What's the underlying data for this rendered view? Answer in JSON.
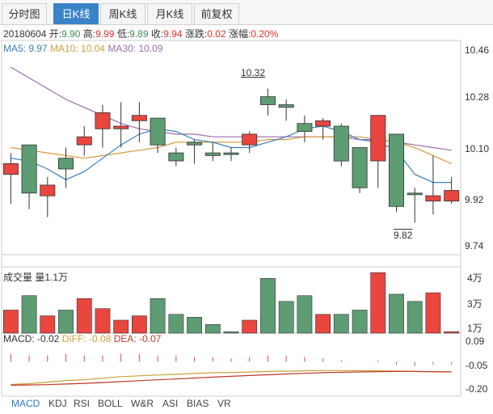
{
  "tabs": [
    {
      "label": "分时图",
      "active": false
    },
    {
      "label": "日K线",
      "active": true
    },
    {
      "label": "周K线",
      "active": false
    },
    {
      "label": "月K线",
      "active": false
    },
    {
      "label": "前复权",
      "active": false
    }
  ],
  "info": {
    "date": "20180604",
    "open_label": "开:",
    "open": "9.90",
    "high_label": "高:",
    "high": "9.99",
    "low_label": "低:",
    "low": "9.89",
    "close_label": "收:",
    "close": "9.94",
    "change_label": "涨跌:",
    "change": "0.02",
    "pct_label": "涨幅:",
    "pct": "0.20%"
  },
  "ma": {
    "ma5": "MA5: 9.97",
    "ma10": "MA10: 10.04",
    "ma30": "MA30: 10.09"
  },
  "price_axis": [
    "10.46",
    "10.28",
    "10.10",
    "9.92",
    "9.74"
  ],
  "annotations": {
    "high": "10.32",
    "low": "9.82"
  },
  "volume": {
    "label": "成交量 量1.1万",
    "axis": [
      "4万",
      "3万",
      "1万"
    ]
  },
  "macd": {
    "label": "MACD: -0.02",
    "diff": "DIFF: -0.08",
    "dea": "DEA: -0.07",
    "axis": [
      "0.09",
      "-0.05",
      "-0.20"
    ]
  },
  "indicators": [
    {
      "label": "MACD",
      "active": true
    },
    {
      "label": "KDJ",
      "active": false
    },
    {
      "label": "RSI",
      "active": false
    },
    {
      "label": "BOLL",
      "active": false
    },
    {
      "label": "W&R",
      "active": false
    },
    {
      "label": "ASI",
      "active": false
    },
    {
      "label": "BIAS",
      "active": false
    },
    {
      "label": "VR",
      "active": false
    }
  ],
  "colors": {
    "up": "#e8463f",
    "down": "#5e9c73",
    "ma5": "#3a7fc0",
    "ma10": "#d89b3c",
    "ma30": "#9a6db0",
    "accent": "#3a83c9"
  },
  "chart_data": {
    "type": "candlestick",
    "candles": [
      {
        "o": 10.0,
        "c": 10.04,
        "h": 10.08,
        "l": 9.89,
        "up": true
      },
      {
        "o": 10.11,
        "c": 9.93,
        "h": 10.11,
        "l": 9.87,
        "up": false
      },
      {
        "o": 9.92,
        "c": 9.96,
        "h": 9.99,
        "l": 9.84,
        "up": true
      },
      {
        "o": 10.02,
        "c": 10.06,
        "h": 10.1,
        "l": 9.95,
        "up": false
      },
      {
        "o": 10.11,
        "c": 10.14,
        "h": 10.18,
        "l": 10.07,
        "up": true
      },
      {
        "o": 10.17,
        "c": 10.23,
        "h": 10.26,
        "l": 10.1,
        "up": true
      },
      {
        "o": 10.17,
        "c": 10.18,
        "h": 10.27,
        "l": 10.1,
        "up": true
      },
      {
        "o": 10.2,
        "c": 10.22,
        "h": 10.27,
        "l": 10.12,
        "up": true
      },
      {
        "o": 10.21,
        "c": 10.11,
        "h": 10.21,
        "l": 10.08,
        "up": false
      },
      {
        "o": 10.08,
        "c": 10.05,
        "h": 10.1,
        "l": 10.03,
        "up": false
      },
      {
        "o": 10.12,
        "c": 10.11,
        "h": 10.13,
        "l": 10.04,
        "up": false
      },
      {
        "o": 10.08,
        "c": 10.07,
        "h": 10.12,
        "l": 10.05,
        "up": false
      },
      {
        "o": 10.08,
        "c": 10.08,
        "h": 10.1,
        "l": 10.05,
        "up": false
      },
      {
        "o": 10.11,
        "c": 10.15,
        "h": 10.16,
        "l": 10.08,
        "up": true
      },
      {
        "o": 10.29,
        "c": 10.26,
        "h": 10.32,
        "l": 10.22,
        "up": false
      },
      {
        "o": 10.26,
        "c": 10.25,
        "h": 10.28,
        "l": 10.2,
        "up": false
      },
      {
        "o": 10.19,
        "c": 10.16,
        "h": 10.22,
        "l": 10.12,
        "up": false
      },
      {
        "o": 10.18,
        "c": 10.2,
        "h": 10.21,
        "l": 10.13,
        "up": true
      },
      {
        "o": 10.18,
        "c": 10.05,
        "h": 10.19,
        "l": 10.03,
        "up": false
      },
      {
        "o": 10.1,
        "c": 9.95,
        "h": 10.1,
        "l": 9.93,
        "up": false
      },
      {
        "o": 10.05,
        "c": 10.22,
        "h": 10.22,
        "l": 9.95,
        "up": true
      },
      {
        "o": 10.15,
        "c": 9.88,
        "h": 10.15,
        "l": 9.86,
        "up": false
      },
      {
        "o": 9.93,
        "c": 9.93,
        "h": 9.95,
        "l": 9.82,
        "up": false
      },
      {
        "o": 9.9,
        "c": 9.92,
        "h": 10.07,
        "l": 9.85,
        "up": true
      },
      {
        "o": 9.9,
        "c": 9.94,
        "h": 9.99,
        "l": 9.89,
        "up": true
      }
    ],
    "ma5": [
      10.06,
      10.05,
      10.02,
      9.98,
      10.01,
      10.06,
      10.11,
      10.15,
      10.17,
      10.16,
      10.13,
      10.12,
      10.1,
      10.1,
      10.12,
      10.14,
      10.17,
      10.18,
      10.16,
      10.13,
      10.12,
      10.09,
      10.0,
      9.97,
      9.97
    ],
    "ma10": [
      10.1,
      10.09,
      10.08,
      10.07,
      10.06,
      10.07,
      10.08,
      10.09,
      10.1,
      10.12,
      10.12,
      10.12,
      10.12,
      10.12,
      10.13,
      10.13,
      10.14,
      10.14,
      10.14,
      10.14,
      10.13,
      10.12,
      10.1,
      10.07,
      10.04
    ],
    "ma30": [
      10.4,
      10.36,
      10.32,
      10.28,
      10.25,
      10.22,
      10.19,
      10.17,
      10.16,
      10.15,
      10.15,
      10.14,
      10.14,
      10.14,
      10.14,
      10.14,
      10.14,
      10.14,
      10.14,
      10.13,
      10.13,
      10.12,
      10.11,
      10.1,
      10.09
    ],
    "price_range": [
      9.7,
      10.5
    ],
    "volume": [
      {
        "v": 1.6,
        "up": true
      },
      {
        "v": 2.6,
        "up": false
      },
      {
        "v": 1.2,
        "up": true
      },
      {
        "v": 1.6,
        "up": false
      },
      {
        "v": 2.4,
        "up": true
      },
      {
        "v": 1.7,
        "up": true
      },
      {
        "v": 0.9,
        "up": true
      },
      {
        "v": 1.2,
        "up": true
      },
      {
        "v": 2.4,
        "up": false
      },
      {
        "v": 1.3,
        "up": false
      },
      {
        "v": 1.1,
        "up": false
      },
      {
        "v": 0.6,
        "up": false
      },
      {
        "v": 0.1,
        "up": false
      },
      {
        "v": 0.9,
        "up": true
      },
      {
        "v": 3.8,
        "up": false
      },
      {
        "v": 2.2,
        "up": false
      },
      {
        "v": 2.6,
        "up": false
      },
      {
        "v": 1.3,
        "up": true
      },
      {
        "v": 1.3,
        "up": false
      },
      {
        "v": 1.6,
        "up": false
      },
      {
        "v": 4.2,
        "up": true
      },
      {
        "v": 2.7,
        "up": false
      },
      {
        "v": 2.2,
        "up": false
      },
      {
        "v": 2.8,
        "up": true
      },
      {
        "v": 0.1,
        "up": true
      }
    ],
    "volume_range": [
      0,
      4.6
    ],
    "macd_hist": [
      0.05,
      0.04,
      0.04,
      0.05,
      0.04,
      0.04,
      0.05,
      0.05,
      0.04,
      0.04,
      0.03,
      0.03,
      0.02,
      0.03,
      0.04,
      0.04,
      0.03,
      0.02,
      0.01,
      0.0,
      0.01,
      -0.02,
      -0.03,
      -0.02,
      -0.02
    ],
    "diff": [
      -0.145,
      -0.14,
      -0.13,
      -0.12,
      -0.115,
      -0.105,
      -0.095,
      -0.09,
      -0.085,
      -0.08,
      -0.075,
      -0.07,
      -0.068,
      -0.065,
      -0.062,
      -0.06,
      -0.058,
      -0.056,
      -0.056,
      -0.057,
      -0.058,
      -0.06,
      -0.062,
      -0.064,
      -0.066
    ],
    "dea": [
      -0.15,
      -0.148,
      -0.146,
      -0.142,
      -0.138,
      -0.133,
      -0.127,
      -0.121,
      -0.115,
      -0.11,
      -0.104,
      -0.098,
      -0.093,
      -0.088,
      -0.083,
      -0.078,
      -0.074,
      -0.07,
      -0.067,
      -0.065,
      -0.063,
      -0.062,
      -0.062,
      -0.063,
      -0.064
    ],
    "macd_range": [
      -0.22,
      0.1
    ]
  }
}
